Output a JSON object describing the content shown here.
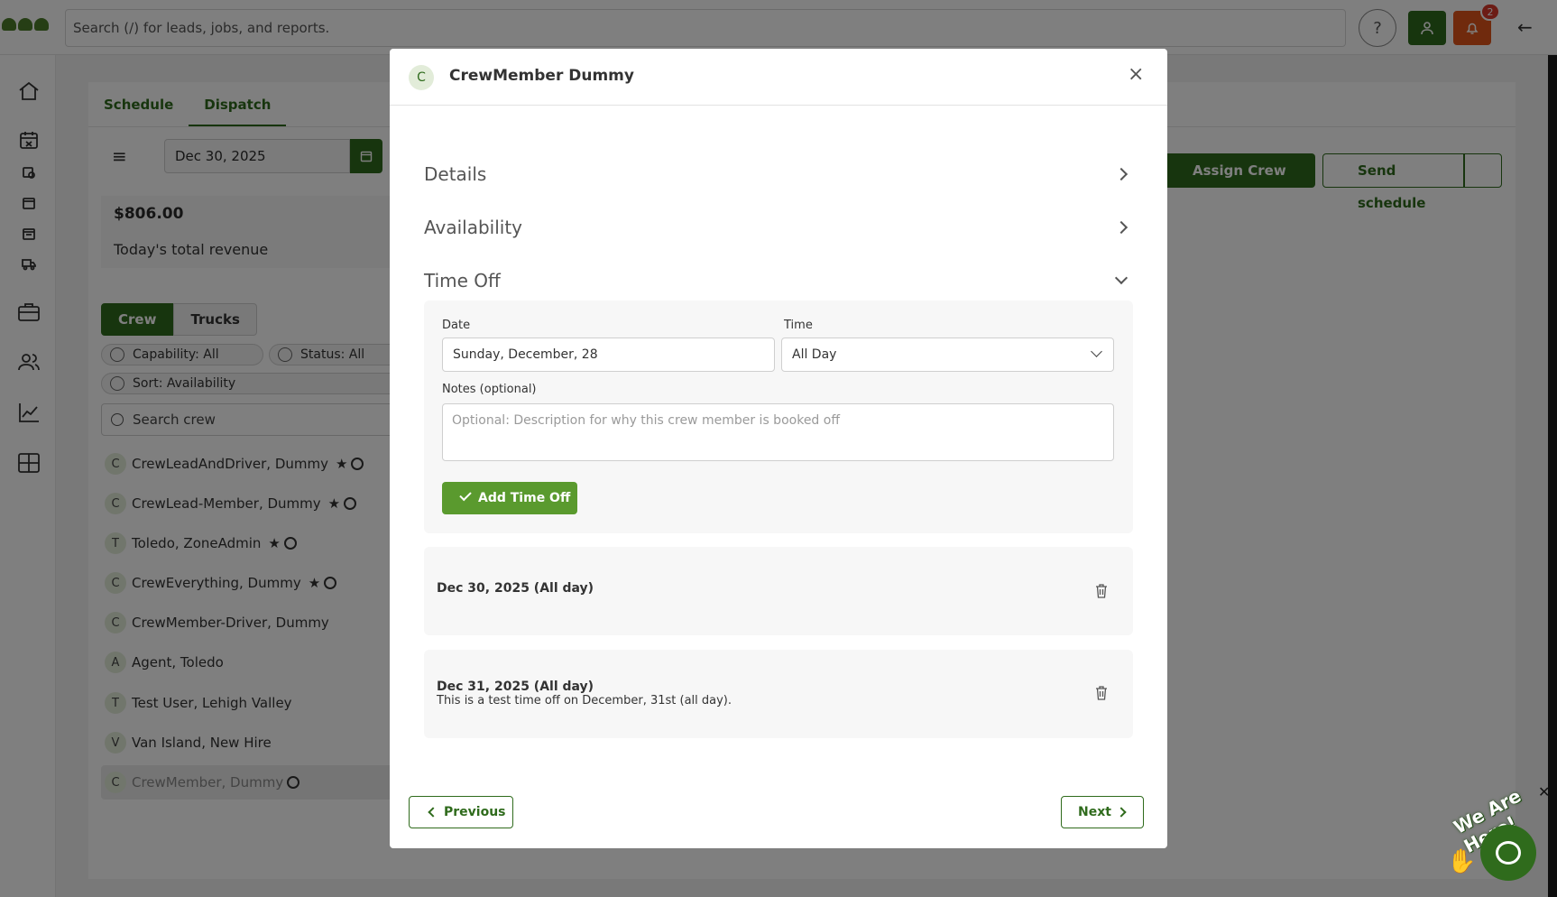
{
  "app": {
    "search_placeholder": "Search (/) for leads, jobs, and reports.",
    "help_icon": "?",
    "notification_count": "2",
    "back_icon": "←"
  },
  "dispatch": {
    "tabs": [
      "Schedule",
      "Dispatch"
    ],
    "active_tab": "Dispatch",
    "date": "Dec 30, 2025",
    "revenue_amount": "$806.00",
    "revenue_label": "Today's total revenue",
    "segment": [
      "Crew",
      "Trucks"
    ],
    "filters": {
      "capability": "Capability: All",
      "status": "Status: All",
      "sort": "Sort: Availability"
    },
    "crew_search_placeholder": "Search crew",
    "assign_crew": "Assign Crew",
    "send_schedule": "Send schedule",
    "crew": [
      {
        "initial": "C",
        "name": "CrewLeadAndDriver, Dummy",
        "star": true,
        "ring": true
      },
      {
        "initial": "C",
        "name": "CrewLead-Member, Dummy",
        "star": true,
        "ring": true
      },
      {
        "initial": "T",
        "name": "Toledo, ZoneAdmin",
        "star": true,
        "ring": true
      },
      {
        "initial": "C",
        "name": "CrewEverything, Dummy",
        "star": true,
        "ring": true
      },
      {
        "initial": "C",
        "name": "CrewMember-Driver, Dummy",
        "star": false,
        "ring": false
      },
      {
        "initial": "A",
        "name": "Agent, Toledo",
        "star": false,
        "ring": false
      },
      {
        "initial": "T",
        "name": "Test User, Lehigh Valley",
        "star": false,
        "ring": false
      },
      {
        "initial": "V",
        "name": "Van Island, New Hire",
        "star": false,
        "ring": false
      },
      {
        "initial": "C",
        "name": "CrewMember, Dummy",
        "star": false,
        "ring": true
      }
    ]
  },
  "modal": {
    "avatar_initial": "C",
    "title": "CrewMember Dummy",
    "sections": {
      "details": "Details",
      "availability": "Availability",
      "time_off": "Time Off"
    },
    "form": {
      "date_label": "Date",
      "date_value": "Sunday, December, 28",
      "time_label": "Time",
      "time_value": "All Day",
      "notes_label": "Notes (optional)",
      "notes_placeholder": "Optional: Description for why this crew member is booked off",
      "add_button": "Add Time Off"
    },
    "entries": [
      {
        "title": "Dec 30, 2025 (All day)",
        "note": ""
      },
      {
        "title": "Dec 31, 2025 (All day)",
        "note": "This is a test time off on December, 31st (all day)."
      }
    ],
    "prev_button": "Previous",
    "next_button": "Next"
  },
  "chat": {
    "banner": "We Are Here!",
    "close": "✕"
  },
  "colors": {
    "brand_green": "#2f6b1c",
    "add_green": "#5a9a2e",
    "alert_orange": "#e0541b"
  }
}
